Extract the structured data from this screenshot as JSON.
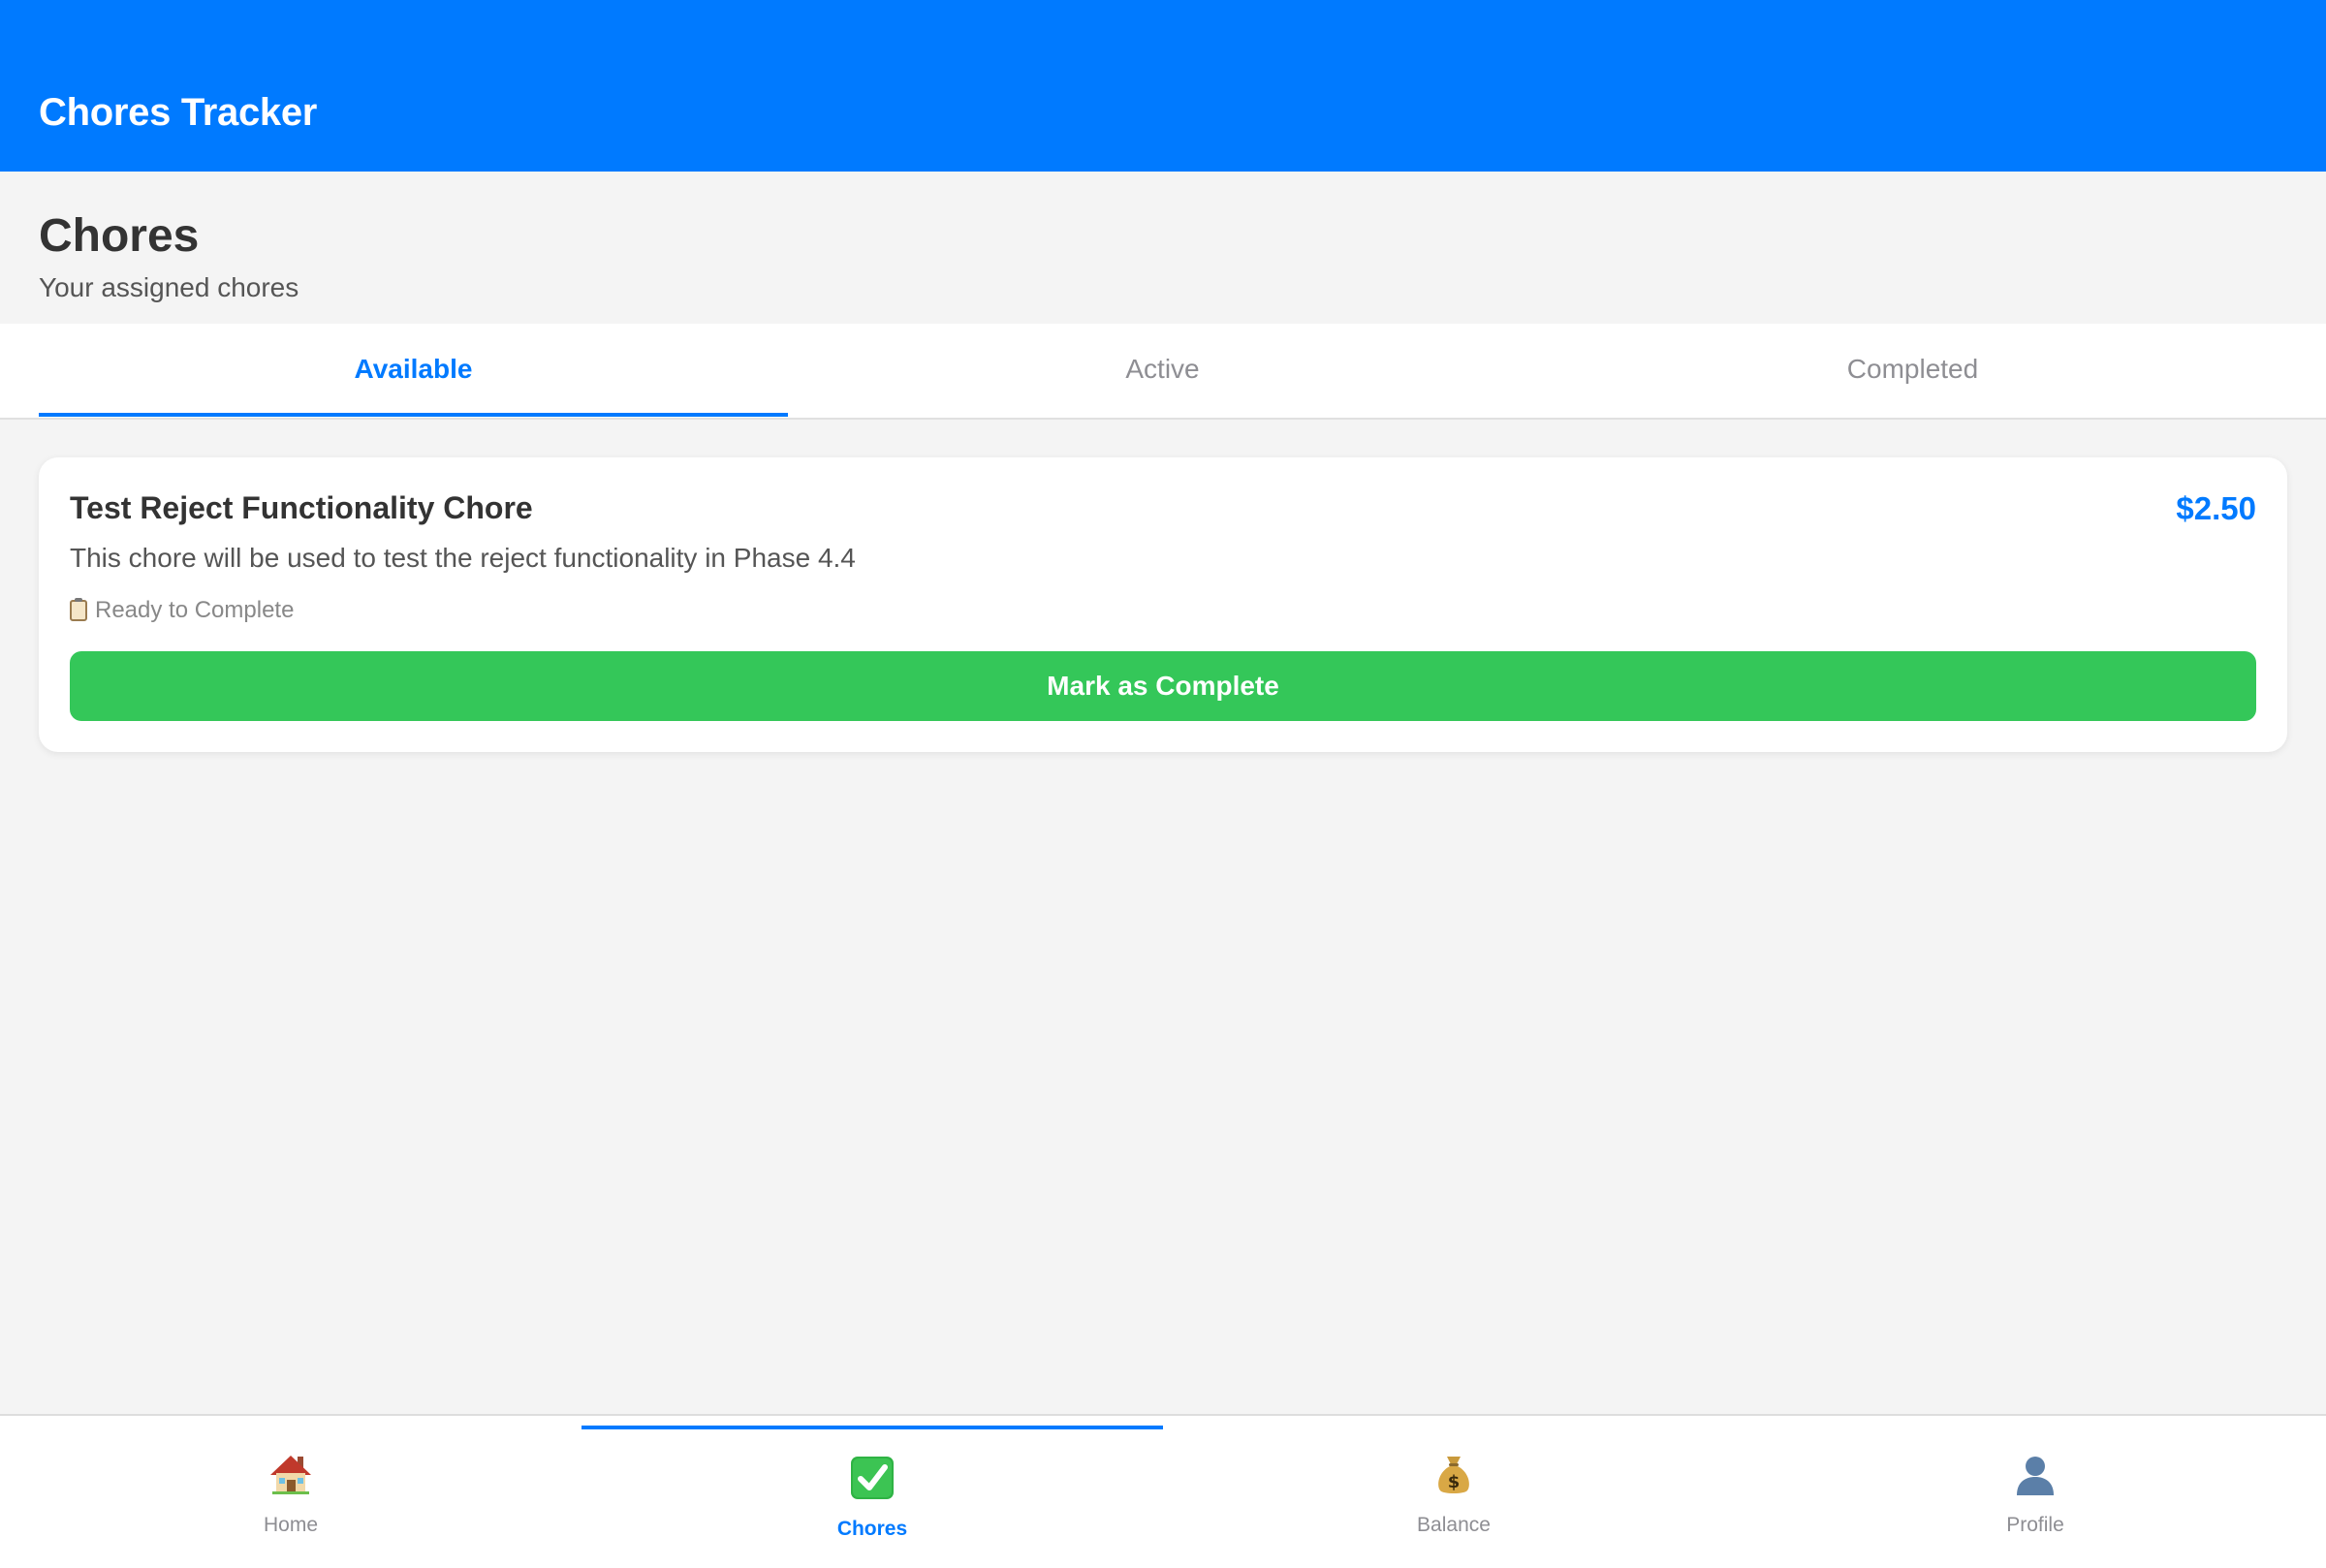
{
  "app": {
    "title": "Chores Tracker",
    "accent_color": "#007aff",
    "success_color": "#34c759"
  },
  "page": {
    "title": "Chores",
    "subtitle": "Your assigned chores"
  },
  "tabs": [
    {
      "label": "Available",
      "active": true
    },
    {
      "label": "Active",
      "active": false
    },
    {
      "label": "Completed",
      "active": false
    }
  ],
  "chores": [
    {
      "title": "Test Reject Functionality Chore",
      "amount": "$2.50",
      "description": "This chore will be used to test the reject functionality in Phase 4.4",
      "status_icon": "clipboard-icon",
      "status": "Ready to Complete",
      "action_label": "Mark as Complete"
    }
  ],
  "bottom_nav": [
    {
      "label": "Home",
      "icon": "house-icon",
      "active": false
    },
    {
      "label": "Chores",
      "icon": "check-mark-icon",
      "active": true
    },
    {
      "label": "Balance",
      "icon": "money-bag-icon",
      "active": false
    },
    {
      "label": "Profile",
      "icon": "user-silhouette-icon",
      "active": false
    }
  ]
}
